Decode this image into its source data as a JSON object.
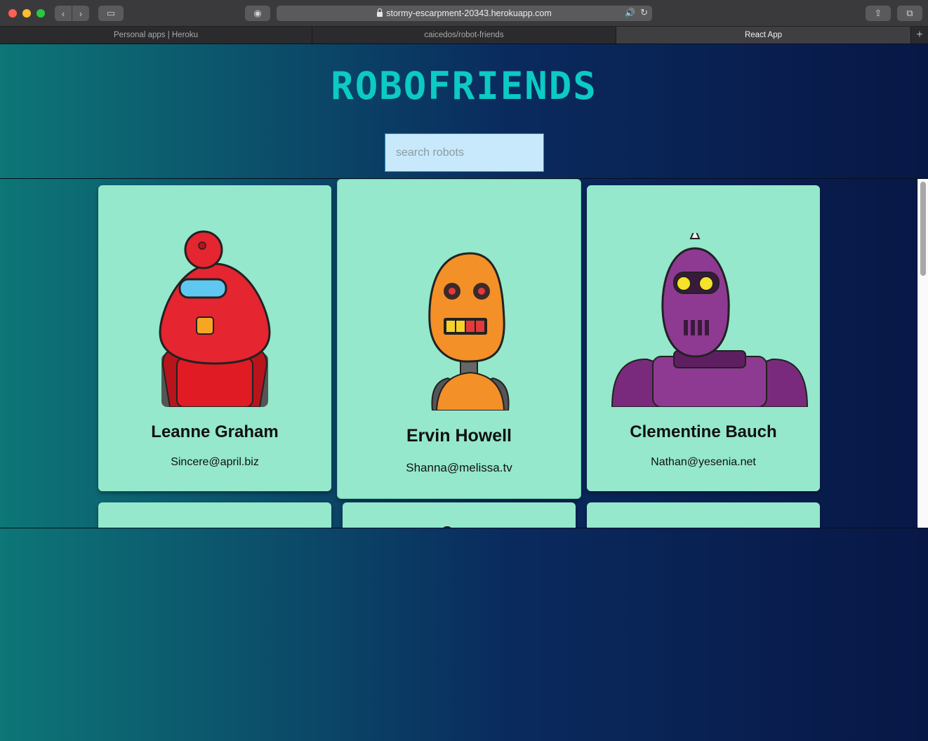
{
  "browser": {
    "url": "stormy-escarpment-20343.herokuapp.com",
    "tabs": [
      {
        "title": "Personal apps | Heroku",
        "active": false
      },
      {
        "title": "caicedos/robot-friends",
        "active": false
      },
      {
        "title": "React App",
        "active": true
      }
    ],
    "new_tab_label": "+",
    "back_icon": "‹",
    "forward_icon": "›",
    "sidebar_icon": "▭",
    "ghost_icon": "◉",
    "share_icon": "⇪",
    "tabs_overview_icon": "⧉",
    "audio_icon": "🔊",
    "reload_icon": "↻"
  },
  "app": {
    "title": "ROBOFRIENDS",
    "search_placeholder": "search robots",
    "search_value": "",
    "colors": {
      "title": "#0ccac4",
      "card": "#95e8cb",
      "search_bg": "#c7e9fb",
      "gradient_start": "#0d7677",
      "gradient_end": "#081746"
    },
    "robots": [
      {
        "name": "Leanne Graham",
        "email": "Sincere@april.biz",
        "color": "red"
      },
      {
        "name": "Ervin Howell",
        "email": "Shanna@melissa.tv",
        "color": "orange"
      },
      {
        "name": "Clementine Bauch",
        "email": "Nathan@yesenia.net",
        "color": "purple"
      }
    ]
  }
}
